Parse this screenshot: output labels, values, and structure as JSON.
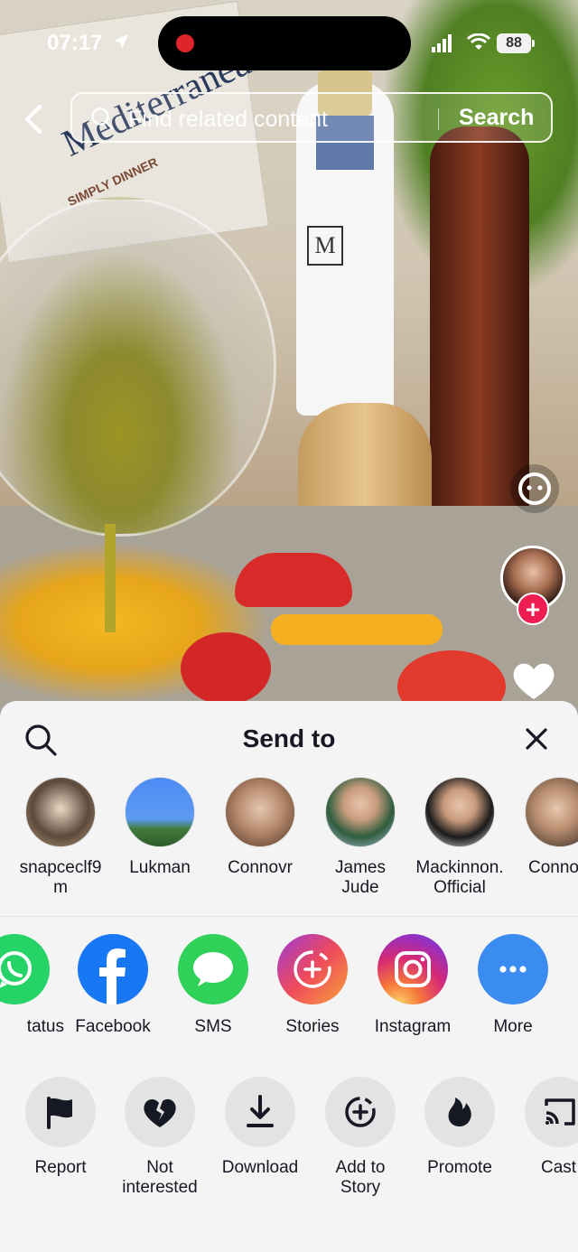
{
  "status_bar": {
    "time": "07:17",
    "battery": "88"
  },
  "top_search": {
    "placeholder": "Find related content",
    "button_label": "Search"
  },
  "background": {
    "book_title": "Mediterranean",
    "book_subtitle": "SIMPLY DINNER",
    "bottle_logo": "M"
  },
  "sheet": {
    "title": "Send to",
    "contacts": [
      {
        "name": "snapceclf9\nm"
      },
      {
        "name": "Lukman"
      },
      {
        "name": "Connovr"
      },
      {
        "name": "James\nJude"
      },
      {
        "name": "Mackinnon.\nOfficial"
      },
      {
        "name": "Conno"
      }
    ],
    "apps": [
      {
        "label": "tatus",
        "icon": "whatsapp-icon",
        "color": "#25d366"
      },
      {
        "label": "Facebook",
        "icon": "facebook-icon",
        "color": "#1877f2"
      },
      {
        "label": "SMS",
        "icon": "sms-icon",
        "color": "#2fd159"
      },
      {
        "label": "Stories",
        "icon": "stories-icon",
        "color": "#ee4a5c"
      },
      {
        "label": "Instagram",
        "icon": "instagram-icon",
        "color": "#d62976"
      },
      {
        "label": "More",
        "icon": "more-icon",
        "color": "#3b8cf0"
      }
    ],
    "actions": [
      {
        "label": "Report",
        "icon": "flag-icon"
      },
      {
        "label": "Not\ninterested",
        "icon": "broken-heart-icon"
      },
      {
        "label": "Download",
        "icon": "download-icon"
      },
      {
        "label": "Add to\nStory",
        "icon": "add-story-icon"
      },
      {
        "label": "Promote",
        "icon": "flame-icon"
      },
      {
        "label": "Cast",
        "icon": "cast-icon"
      }
    ]
  },
  "colors": {
    "follow_badge": "#ee1d52",
    "record_dot": "#e0242b",
    "sheet_bg": "#f4f4f4"
  }
}
